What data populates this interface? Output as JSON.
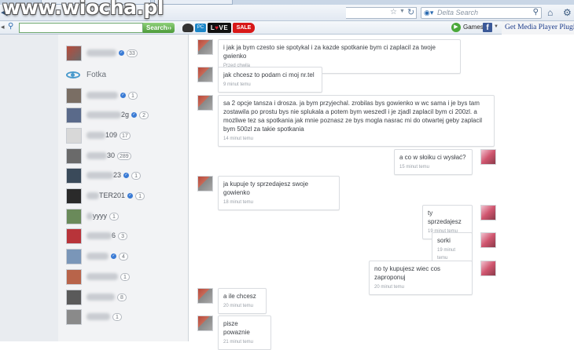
{
  "watermark": "www.wiocha.pl",
  "browser": {
    "search_placeholder": "Delta Search",
    "icons": [
      "back-arrow-icon",
      "star-icon",
      "reload-icon",
      "search-engine-icon",
      "magnifier-icon",
      "home-icon",
      "gear-icon"
    ]
  },
  "toolbar": {
    "search_button": "Search",
    "love_label_lo": "L",
    "love_label_heart": "♥",
    "love_label_ve": "VE",
    "sale_label": "SALE",
    "games_label": "Games",
    "facebook_label": "f",
    "media_player_link": "Get Media Player Plugin"
  },
  "sidebar": {
    "top_contact_count": "33",
    "fotka_label": "Fotka",
    "contacts": [
      {
        "name_suffix": "",
        "count": "1",
        "verified": true
      },
      {
        "name_suffix": "2g",
        "count": "2",
        "verified": true
      },
      {
        "name_suffix": "109",
        "count": "17",
        "verified": false
      },
      {
        "name_suffix": "30",
        "count": "289",
        "verified": false
      },
      {
        "name_suffix": "23",
        "count": "1",
        "verified": true
      },
      {
        "name_suffix": "TER201",
        "count": "1",
        "verified": true
      },
      {
        "name_suffix": "yyyy",
        "count": "1",
        "verified": false
      },
      {
        "name_suffix": "6",
        "count": "3",
        "verified": false
      },
      {
        "name_suffix": "",
        "count": "4",
        "verified": true
      },
      {
        "name_suffix": "",
        "count": "1",
        "verified": false
      },
      {
        "name_suffix": "",
        "count": "8",
        "verified": false
      },
      {
        "name_suffix": "",
        "count": "1",
        "verified": false
      }
    ]
  },
  "messages": [
    {
      "side": "left",
      "text": "i jak ja bym czesto sie spotykal i za kazde spotkanie bym ci zaplacil za twoje gwienko",
      "time": "Przed chwilą"
    },
    {
      "side": "left",
      "text": "jak chcesz to podam ci moj nr.tel",
      "time": "9 minut temu"
    },
    {
      "side": "left",
      "text": "sa 2 opcje tansza i drosza. ja bym przyjechal. zrobilas bys gowienko w wc sama i je bys tam zostawila po prostu bys nie splukala a potem bym weszedl i je zjadl zaplacil bym ci 200zl. a mozliwe tez sa spotkania jak mnie poznasz ze bys mogla nasrac mi do otwartej geby zaplacil bym 500zl za takie spotkania",
      "time": "14 minut temu"
    },
    {
      "side": "right",
      "text": "a co w słoiku ci wysłać?",
      "time": "15 minut temu"
    },
    {
      "side": "left",
      "text": "ja kupuje ty sprzedajesz swoje gowienko",
      "time": "18 minut temu"
    },
    {
      "side": "right",
      "text": "ty sprzedajesz",
      "time": "19 minut temu"
    },
    {
      "side": "right",
      "text": "sorki",
      "time": "19 minut temu"
    },
    {
      "side": "right",
      "text": "no ty kupujesz wiec cos zaproponuj",
      "time": "20 minut temu"
    },
    {
      "side": "left",
      "text": "a ile chcesz",
      "time": "20 minut temu"
    },
    {
      "side": "left",
      "text": "pisze powaznie",
      "time": "21 minut temu"
    }
  ]
}
